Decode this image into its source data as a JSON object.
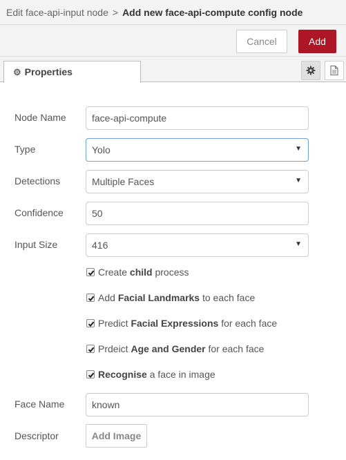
{
  "header": {
    "breadcrumb_parent": "Edit face-api-input node",
    "separator": ">",
    "breadcrumb_current": "Add new face-api-compute config node"
  },
  "toolbar": {
    "cancel_label": "Cancel",
    "add_label": "Add"
  },
  "tabs": {
    "properties_label": "Properties",
    "icons": [
      "gear-icon",
      "document-icon"
    ]
  },
  "form": {
    "node_name": {
      "label": "Node Name",
      "value": "face-api-compute"
    },
    "type": {
      "label": "Type",
      "value": "Yolo"
    },
    "detections": {
      "label": "Detections",
      "value": "Multiple Faces"
    },
    "confidence": {
      "label": "Confidence",
      "value": "50"
    },
    "input_size": {
      "label": "Input Size",
      "value": "416"
    },
    "checkboxes": [
      {
        "checked": true,
        "pre": "Create ",
        "bold": "child",
        "post": " process"
      },
      {
        "checked": true,
        "pre": "Add ",
        "bold": "Facial Landmarks",
        "post": " to each face"
      },
      {
        "checked": true,
        "pre": "Predict ",
        "bold": "Facial Expressions",
        "post": " for each face"
      },
      {
        "checked": true,
        "pre": "Prdeict ",
        "bold": "Age and Gender",
        "post": " for each face"
      },
      {
        "checked": true,
        "pre": "",
        "bold": "Recognise",
        "post": " a face in image"
      }
    ],
    "face_name": {
      "label": "Face Name",
      "value": "known"
    },
    "descriptor": {
      "label": "Descriptor",
      "button_label": "Add Image"
    }
  },
  "colors": {
    "accent": "#ad1625",
    "focus_border": "#6fa0d8",
    "background": "#f3f3f3"
  }
}
